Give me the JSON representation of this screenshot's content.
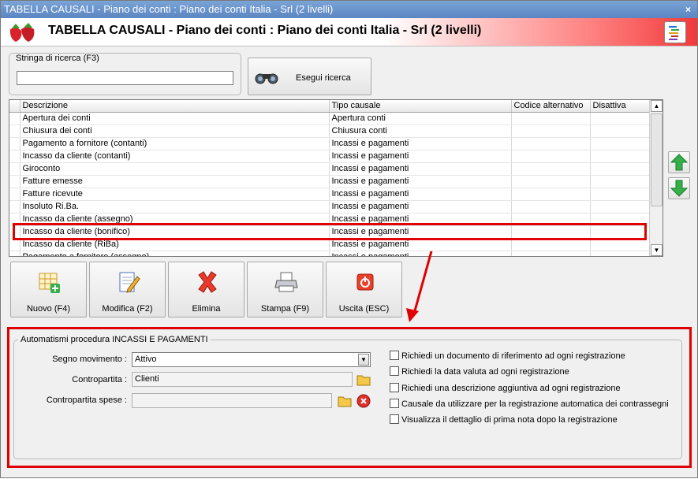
{
  "window": {
    "title": "TABELLA CAUSALI - Piano dei conti : Piano dei conti Italia - Srl (2 livelli)",
    "close_glyph": "×"
  },
  "header": {
    "title": "TABELLA CAUSALI - Piano dei conti : Piano dei conti Italia - Srl (2 livelli)",
    "logo_icon": "strawberries-icon",
    "menu_icon": "list-icon"
  },
  "search": {
    "legend": "Stringa di ricerca (F3)",
    "value": "",
    "button_label": "Esegui ricerca",
    "button_icon": "binoculars-icon"
  },
  "grid": {
    "columns": [
      "Descrizione",
      "Tipo causale",
      "Codice alternativo",
      "Disattiva"
    ],
    "rows": [
      [
        "Apertura dei conti",
        "Apertura conti",
        "",
        ""
      ],
      [
        "Chiusura dei conti",
        "Chiusura conti",
        "",
        ""
      ],
      [
        "Pagamento a fornitore (contanti)",
        "Incassi e pagamenti",
        "",
        ""
      ],
      [
        "Incasso da cliente (contanti)",
        "Incassi e pagamenti",
        "",
        ""
      ],
      [
        "Giroconto",
        "Incassi e pagamenti",
        "",
        ""
      ],
      [
        "Fatture emesse",
        "Incassi e pagamenti",
        "",
        ""
      ],
      [
        "Fatture ricevute",
        "Incassi e pagamenti",
        "",
        ""
      ],
      [
        "Insoluto Ri.Ba.",
        "Incassi e pagamenti",
        "",
        ""
      ],
      [
        "Incasso da cliente (assegno)",
        "Incassi e pagamenti",
        "",
        ""
      ],
      [
        "Incasso da cliente (bonifico)",
        "Incassi e pagamenti",
        "",
        ""
      ],
      [
        "Incasso da cliente (RiBa)",
        "Incassi e pagamenti",
        "",
        ""
      ],
      [
        "Pagamento a fornitore (assegno)",
        "Incassi e pagamenti",
        "",
        ""
      ]
    ],
    "selected_row": 9
  },
  "toolbar": {
    "new_label": "Nuovo (F4)",
    "edit_label": "Modifica (F2)",
    "delete_label": "Elimina",
    "print_label": "Stampa (F9)",
    "exit_label": "Uscita (ESC)"
  },
  "automation": {
    "legend": "Automatismi procedura INCASSI E PAGAMENTI",
    "segno_label": "Segno movimento :",
    "segno_value": "Attivo",
    "contropartita_label": "Contropartita :",
    "contropartita_value": "Clienti",
    "contropartita_spese_label": "Contropartita spese :",
    "contropartita_spese_value": "",
    "checks": [
      {
        "label": "Richiedi un documento di riferimento ad ogni registrazione",
        "checked": false
      },
      {
        "label": "Richiedi la data valuta ad ogni registrazione",
        "checked": false
      },
      {
        "label": "Richiedi una descrizione aggiuntiva ad ogni registrazione",
        "checked": false
      },
      {
        "label": "Causale da utilizzare per la registrazione automatica dei contrassegni",
        "checked": false
      },
      {
        "label": "Visualizza il dettaglio di prima nota dopo la registrazione",
        "checked": false
      }
    ]
  },
  "colors": {
    "highlight": "#e00000",
    "header_gradient_end": "#f03a3a",
    "titlebar": "#5b86c2"
  }
}
